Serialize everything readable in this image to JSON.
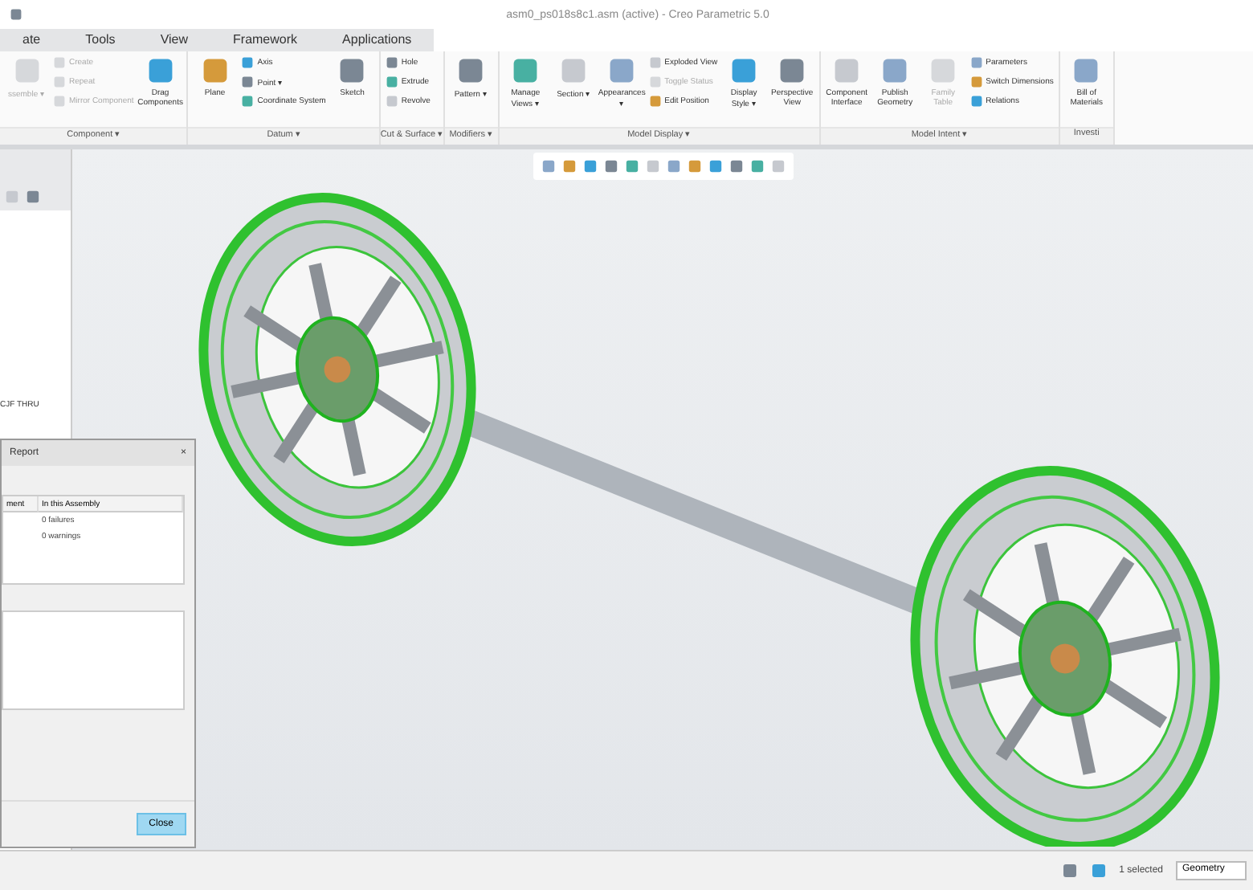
{
  "window": {
    "title": "asm0_ps018s8c1.asm (active) - Creo Parametric 5.0"
  },
  "tabs": [
    {
      "label": "ate",
      "selected": false
    },
    {
      "label": "Tools",
      "selected": false
    },
    {
      "label": "View",
      "selected": false
    },
    {
      "label": "Framework",
      "selected": false
    },
    {
      "label": "Applications",
      "selected": false
    }
  ],
  "ribbon": [
    {
      "label": "Component ▾",
      "columns": [
        {
          "kind": "large",
          "items": [
            {
              "label": "ssemble ▾",
              "disabled": true
            }
          ]
        },
        {
          "kind": "stack",
          "items": [
            {
              "label": "Create",
              "disabled": true
            },
            {
              "label": "Repeat",
              "disabled": true
            },
            {
              "label": "Mirror Component",
              "disabled": true
            }
          ]
        },
        {
          "kind": "large",
          "items": [
            {
              "label": "Drag Components",
              "disabled": false
            }
          ]
        }
      ]
    },
    {
      "label": "Datum ▾",
      "columns": [
        {
          "kind": "large",
          "items": [
            {
              "label": "Plane",
              "disabled": false
            }
          ]
        },
        {
          "kind": "stack",
          "items": [
            {
              "label": "Axis",
              "disabled": false
            },
            {
              "label": "Point ▾",
              "disabled": false
            },
            {
              "label": "Coordinate System",
              "disabled": false
            }
          ]
        },
        {
          "kind": "large",
          "items": [
            {
              "label": "Sketch",
              "disabled": false
            }
          ]
        }
      ]
    },
    {
      "label": "Cut & Surface ▾",
      "columns": [
        {
          "kind": "stack",
          "items": [
            {
              "label": "Hole",
              "disabled": false
            },
            {
              "label": "Extrude",
              "disabled": false
            },
            {
              "label": "Revolve",
              "disabled": false
            }
          ]
        }
      ]
    },
    {
      "label": "Modifiers ▾",
      "columns": [
        {
          "kind": "large",
          "items": [
            {
              "label": "Pattern ▾",
              "disabled": false
            }
          ]
        }
      ]
    },
    {
      "label": "Model Display ▾",
      "columns": [
        {
          "kind": "large",
          "items": [
            {
              "label": "Manage Views ▾",
              "disabled": false
            }
          ]
        },
        {
          "kind": "large",
          "items": [
            {
              "label": "Section ▾",
              "disabled": false
            }
          ]
        },
        {
          "kind": "large",
          "items": [
            {
              "label": "Appearances ▾",
              "disabled": false
            }
          ]
        },
        {
          "kind": "stack",
          "items": [
            {
              "label": "Exploded View",
              "disabled": false
            },
            {
              "label": "Toggle Status",
              "disabled": true
            },
            {
              "label": "Edit Position",
              "disabled": false
            }
          ]
        },
        {
          "kind": "large",
          "items": [
            {
              "label": "Display Style ▾",
              "disabled": false
            }
          ]
        },
        {
          "kind": "large",
          "items": [
            {
              "label": "Perspective View",
              "disabled": false
            }
          ]
        }
      ]
    },
    {
      "label": "Model Intent ▾",
      "columns": [
        {
          "kind": "large",
          "items": [
            {
              "label": "Component Interface",
              "disabled": false
            }
          ]
        },
        {
          "kind": "large",
          "items": [
            {
              "label": "Publish Geometry",
              "disabled": false
            }
          ]
        },
        {
          "kind": "large",
          "items": [
            {
              "label": "Family Table",
              "disabled": true
            }
          ]
        },
        {
          "kind": "stack",
          "items": [
            {
              "label": "Parameters",
              "disabled": false
            },
            {
              "label": "Switch Dimensions",
              "disabled": false
            },
            {
              "label": "Relations",
              "disabled": false
            }
          ]
        }
      ]
    },
    {
      "label": "Investi",
      "columns": [
        {
          "kind": "large",
          "items": [
            {
              "label": "Bill of Materials",
              "disabled": false
            }
          ]
        }
      ]
    }
  ],
  "model_tree": {
    "items": [
      "CJF THRU"
    ]
  },
  "dialog": {
    "title": "Report",
    "close_glyph": "×",
    "columns": [
      "ment",
      "In this Assembly"
    ],
    "rows": [
      [
        "",
        "0 failures"
      ],
      [
        "",
        "0 warnings"
      ]
    ],
    "button": "Close"
  },
  "status_bar": {
    "selection": "1 selected",
    "filter": "Geometry"
  }
}
